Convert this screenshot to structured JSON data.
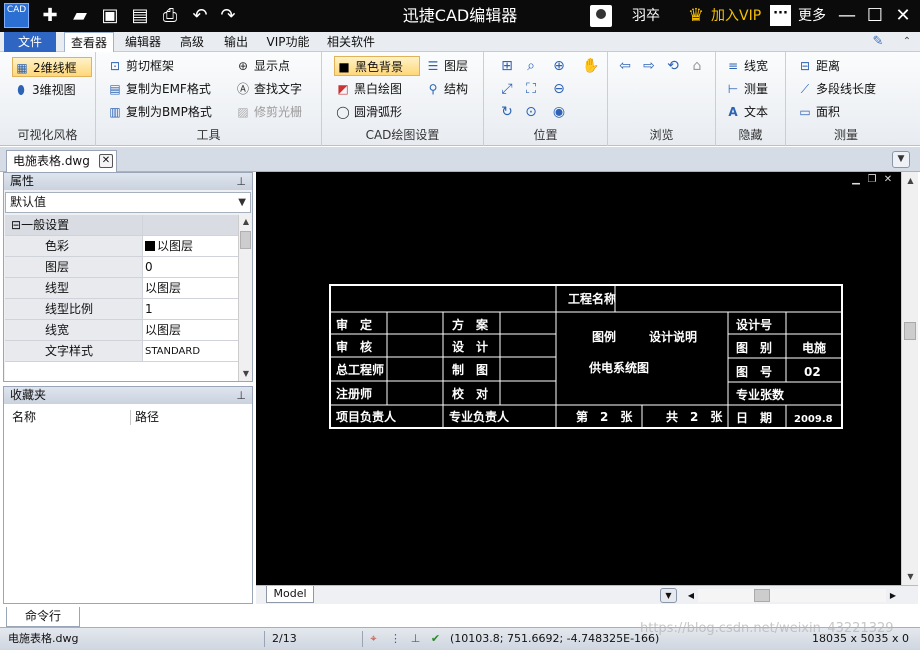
{
  "titlebar": {
    "app_icon_text": "CAD",
    "title": "迅捷CAD编辑器",
    "user_name": "羽卒",
    "vip_label": "加入VIP",
    "more_label": "更多",
    "more_icon": "···"
  },
  "menu": {
    "file": "文件",
    "tabs": [
      "查看器",
      "编辑器",
      "高级",
      "输出",
      "VIP功能",
      "相关软件"
    ],
    "active_tab": "查看器"
  },
  "ribbon": {
    "visual_style": {
      "label": "可视化风格",
      "wireframe_2d": "2维线框",
      "view_3d": "3维视图"
    },
    "tools": {
      "label": "工具",
      "clip_frame": "剪切框架",
      "copy_emf": "复制为EMF格式",
      "copy_bmp": "复制为BMP格式",
      "show_points": "显示点",
      "find_text": "查找文字",
      "trim_raster": "修剪光栅"
    },
    "cad_settings": {
      "label": "CAD绘图设置",
      "black_bg": "黑色背景",
      "bw_drawing": "黑白绘图",
      "smooth_arc": "圆滑弧形",
      "layers": "图层",
      "structure": "结构"
    },
    "position": {
      "label": "位置"
    },
    "browse": {
      "label": "浏览"
    },
    "hide": {
      "label": "隐藏",
      "line_width": "线宽",
      "measure": "测量",
      "text": "文本"
    },
    "measure": {
      "label": "测量",
      "distance": "距离",
      "polyline_length": "多段线长度",
      "area": "面积"
    }
  },
  "document": {
    "tab_name": "电施表格.dwg",
    "close_icon": "✕"
  },
  "properties": {
    "title": "属性",
    "pin_icon": "⊥",
    "preset": "默认值",
    "section": "一般设置",
    "rows": [
      {
        "name": "色彩",
        "value": "以图层"
      },
      {
        "name": "图层",
        "value": "0"
      },
      {
        "name": "线型",
        "value": "以图层"
      },
      {
        "name": "线型比例",
        "value": "1"
      },
      {
        "name": "线宽",
        "value": "以图层"
      },
      {
        "name": "文字样式",
        "value": "STANDARD"
      }
    ]
  },
  "favorites": {
    "title": "收藏夹",
    "col_name": "名称",
    "col_path": "路径"
  },
  "command_tab": "命令行",
  "layout_tab": "Model",
  "drawing": {
    "project_name": "工程名称",
    "left_rows": [
      [
        "审　定",
        "方　案"
      ],
      [
        "审　核",
        "设　计"
      ],
      [
        "总工程师",
        "制　图"
      ],
      [
        "注册师",
        "校　对"
      ],
      [
        "项目负责人",
        "专业负责人"
      ]
    ],
    "legend": "图例",
    "design_note": "设计说明",
    "system_diagram": "供电系统图",
    "sheet_no": "第　2　张",
    "sheet_total": "共　2　张",
    "right_rows": [
      {
        "label": "设计号",
        "value": ""
      },
      {
        "label": "图　别",
        "value": "电施"
      },
      {
        "label": "图　号",
        "value": "02"
      },
      {
        "label": "专业张数",
        "value": ""
      },
      {
        "label": "日　期",
        "value": "2009.8"
      }
    ]
  },
  "status": {
    "file": "电施表格.dwg",
    "page": "2/13",
    "coords": "(10103.8; 751.6692; -4.748325E-166)",
    "size": "18035 x 5035 x 0"
  },
  "watermark": "https://blog.csdn.net/weixin_43221329",
  "colors": {
    "canvas_bg": "#000000",
    "drawing_lines": "#ffffff",
    "vip_gold": "#f5c000",
    "file_tab_blue": "#2f66c4"
  }
}
